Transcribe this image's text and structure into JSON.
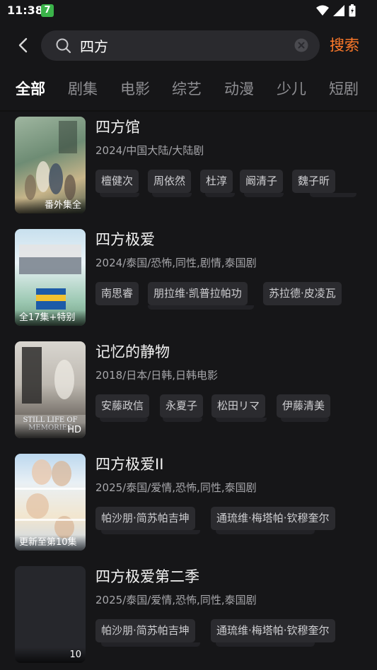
{
  "status": {
    "time": "11:38",
    "badge": "7"
  },
  "search": {
    "query": "四方",
    "placeholder": "",
    "submit_label": "搜索"
  },
  "tabs": [
    {
      "label": "全部",
      "active": true
    },
    {
      "label": "剧集"
    },
    {
      "label": "电影"
    },
    {
      "label": "综艺"
    },
    {
      "label": "动漫"
    },
    {
      "label": "少儿"
    },
    {
      "label": "短剧"
    }
  ],
  "results": [
    {
      "title": "四方馆",
      "meta": "2024/中国大陆/大陆剧",
      "badge": "番外集全",
      "tags": [
        "檀健次",
        "周依然",
        "杜淳",
        "阚清子",
        "魏子昕"
      ]
    },
    {
      "title": "四方极爱",
      "meta": "2024/泰国/恐怖,同性,剧情,泰国剧",
      "badge": "全17集+特别",
      "tags": [
        "南思睿",
        "朋拉维·凯普拉帕功",
        "苏拉德·皮凌瓦"
      ]
    },
    {
      "title": "记忆的静物",
      "meta": "2018/日本/日韩,日韩电影",
      "badge": "HD",
      "poster_text": "STILL LIFE OF MEMORIES",
      "tags": [
        "安藤政信",
        "永夏子",
        "松田リマ",
        "伊藤清美"
      ]
    },
    {
      "title": "四方极爱II",
      "meta": "2025/泰国/爱情,恐怖,同性,泰国剧",
      "badge": "更新至第10集",
      "tags": [
        "帕沙朋·简苏帕吉坤",
        "通琉维·梅塔帕·钦穆奎尔"
      ]
    },
    {
      "title": "四方极爱第二季",
      "meta": "2025/泰国/爱情,恐怖,同性,泰国剧",
      "badge": "10",
      "tags": [
        "帕沙朋·简苏帕吉坤",
        "通琉维·梅塔帕·钦穆奎尔"
      ]
    }
  ],
  "colors": {
    "accent": "#ff7a2a",
    "background": "#161618",
    "tag_bg": "#2b2b2f"
  },
  "icons": {
    "back": "chevron-left-icon",
    "search": "search-icon",
    "clear": "clear-icon"
  }
}
